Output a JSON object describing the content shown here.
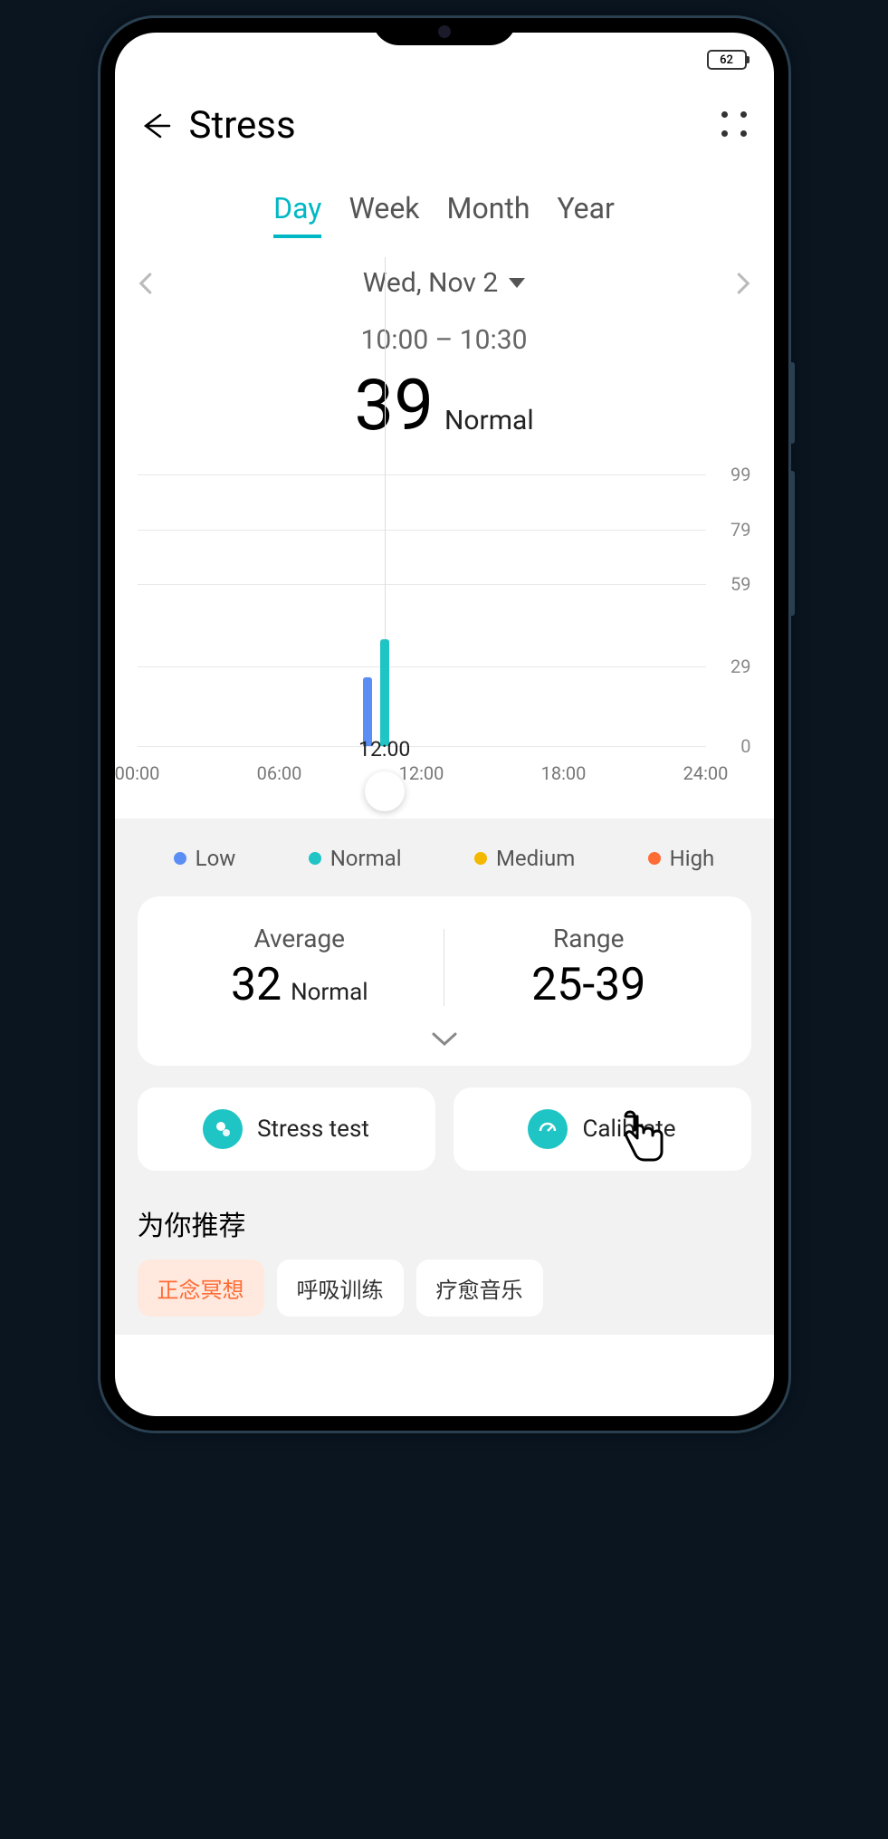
{
  "status": {
    "battery": "62"
  },
  "header": {
    "title": "Stress"
  },
  "tabs": {
    "items": [
      "Day",
      "Week",
      "Month",
      "Year"
    ],
    "active_index": 0
  },
  "date": {
    "label": "Wed, Nov 2",
    "time_range": "10:00 – 10:30"
  },
  "reading": {
    "value": "39",
    "status": "Normal"
  },
  "chart_data": {
    "type": "bar",
    "ylim": [
      0,
      99
    ],
    "y_ticks": [
      0,
      29,
      59,
      79,
      99
    ],
    "x_ticks": [
      "00:00",
      "06:00",
      "12:00",
      "18:00",
      "24:00"
    ],
    "selected_x": "12:00",
    "series": [
      {
        "name": "Low",
        "color": "#5b8ef5",
        "bars": [
          {
            "x_pct": 40.5,
            "value": 25
          }
        ]
      },
      {
        "name": "Normal",
        "color": "#1fc4c4",
        "bars": [
          {
            "x_pct": 43.5,
            "value": 39
          }
        ]
      }
    ],
    "vline_x_pct": 43.5,
    "handle_x_pct": 43.5
  },
  "legend": [
    {
      "label": "Low",
      "color": "#5b8ef5"
    },
    {
      "label": "Normal",
      "color": "#1fc4c4"
    },
    {
      "label": "Medium",
      "color": "#f5b800"
    },
    {
      "label": "High",
      "color": "#ff6b35"
    }
  ],
  "stats": {
    "average": {
      "label": "Average",
      "value": "32",
      "status": "Normal"
    },
    "range": {
      "label": "Range",
      "value": "25-39"
    }
  },
  "actions": {
    "stress_test": "Stress test",
    "calibrate": "Calibrate"
  },
  "recommend": {
    "title": "为你推荐",
    "chips": [
      "正念冥想",
      "呼吸训练",
      "疗愈音乐"
    ],
    "active_index": 0
  }
}
